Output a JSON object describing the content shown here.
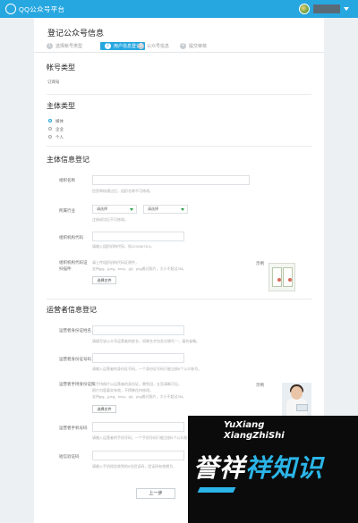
{
  "header": {
    "brand": "QQ公众号平台",
    "colors": {
      "topbar": "#27a7e0",
      "accent": "#27a7e0",
      "watermark_blue": "#2bb5e8"
    }
  },
  "page": {
    "title": "登记公众号信息",
    "steps": [
      {
        "num": "1",
        "label": "选择帐号类型",
        "active": false
      },
      {
        "num": "2",
        "label": "用户信息登记",
        "active": true
      },
      {
        "num": "3",
        "label": "公众号信息",
        "active": false
      },
      {
        "num": "4",
        "label": "提交审核",
        "active": false
      }
    ]
  },
  "account_type": {
    "title": "帐号类型",
    "value": "订阅号"
  },
  "entity_type": {
    "title": "主体类型",
    "options": [
      "媒体",
      "企业",
      "个人"
    ],
    "selected_index": 0
  },
  "entity_info": {
    "title": "主体信息登记",
    "name_label": "组织名称",
    "name_hint": "信息审核通过后，组织名称不可修改。",
    "industry_label": "所属行业",
    "industry_select_1": "请选择",
    "industry_select_2": "请选择",
    "industry_hint": "注册成功后不可修改。",
    "org_code_label": "组织机构代码",
    "org_code_hint": "请输入组织机构代码，如12345678-9。",
    "cert_label_line1": "组织机构代码证",
    "cert_label_line2": "扫描件",
    "cert_hint_line1": "请上传组织机构代码证原件，",
    "cert_hint_line2": "支持jpg、jpeg、bmp、gif、png格式照片，大小不超过2M。",
    "cert_button": "选择文件",
    "example_label": "示例"
  },
  "operator_info": {
    "title": "运营者信息登记",
    "name_label": "运营者身份证姓名",
    "name_hint": "请填写该公众号运营者的姓名，如果名字包含分隔号\"·\"，请勿省略。",
    "id_label": "运营者身份证号码",
    "id_hint": "请输入运营者的身份证号码，一个身份证号码只能注册5个公众账号。",
    "photo_label": "运营者手持身份证照",
    "photo_hint_line1": "以手持照片以运营者的身份证，需免冠，五官清晰可见，",
    "photo_hint_line2": "照片内容真实有效，不得做任何修改。",
    "photo_hint_line3": "支持jpg、jpeg、bmp、gif、png格式照片，大小不超过2M。",
    "photo_button": "选择文件",
    "example_label": "示例",
    "phone_label": "运营者手机号码",
    "phone_hint": "请输入运营者的手机号码，一个手机号码只能注册5个公众账号。",
    "sms_label": "短信验证码",
    "sms_hint": "请输入手机短信收到的6位验证码，验证码有效期为..."
  },
  "footer": {
    "prev_button": "上一步"
  },
  "watermark": {
    "line1": "YuXiang",
    "line2": "XiangZhiShi",
    "brand_part1": "誉祥",
    "brand_part2": "祥知识"
  }
}
